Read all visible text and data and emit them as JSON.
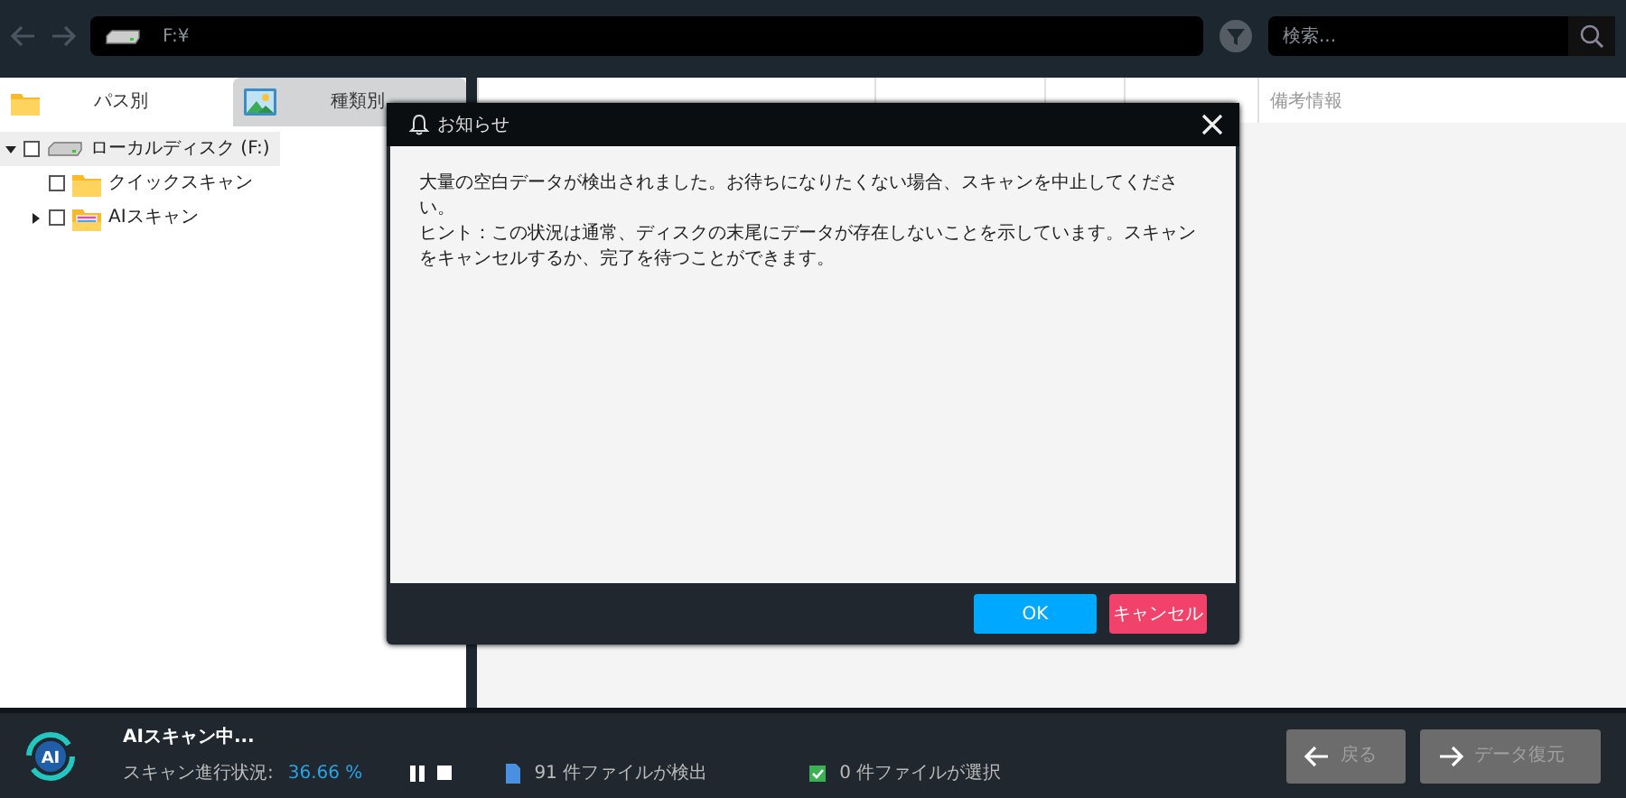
{
  "toolbar": {
    "path": "F:¥",
    "search": {
      "placeholder": "検索..."
    }
  },
  "tabs": [
    {
      "label": "パス別",
      "selected": true,
      "kind": "folder"
    },
    {
      "label": "種類別",
      "selected": false,
      "kind": "image"
    }
  ],
  "tree": [
    {
      "label": "ローカルディスク (F:)",
      "kind": "drive",
      "expanded": true,
      "checked": false,
      "selected": true,
      "children": [
        {
          "label": "クイックスキャン",
          "kind": "folder",
          "checked": false,
          "selected": false
        },
        {
          "label": "AIスキャン",
          "kind": "ai-folder",
          "expanded": false,
          "checked": false,
          "selected": false
        }
      ]
    }
  ],
  "table": {
    "columns": [
      {
        "label": "備考情報"
      }
    ]
  },
  "dialog": {
    "title": "お知らせ",
    "paragraphs": [
      "大量の空白データが検出されました。お待ちになりたくない場合、スキャンを中止してください。",
      "ヒント：この状況は通常、ディスクの末尾にデータが存在しないことを示しています。スキャンをキャンセルするか、完了を待つことができます。"
    ],
    "buttons": [
      {
        "label": "OK",
        "kind": "primary"
      },
      {
        "label": "キャンセル",
        "kind": "danger"
      }
    ]
  },
  "status": {
    "logo_text": "AI",
    "title": "AIスキャン中...",
    "progress_label": "スキャン進行状況:",
    "progress_value": "36.66 %",
    "found": "91 件ファイルが検出",
    "selected_count": "0 件ファイルが選択",
    "buttons": [
      {
        "label": "戻る",
        "kind": "back",
        "disabled": true
      },
      {
        "label": "データ復元",
        "kind": "recover",
        "disabled": true
      }
    ]
  }
}
